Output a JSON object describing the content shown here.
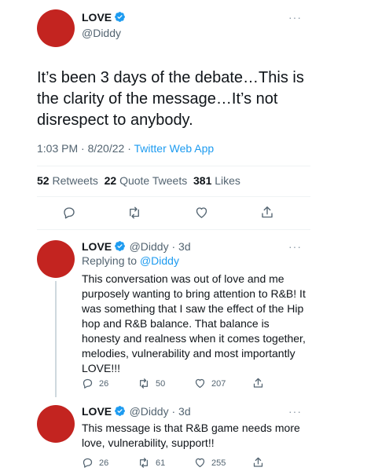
{
  "main_tweet": {
    "author_name": "LOVE",
    "author_handle": "@Diddy",
    "more": "···",
    "text": "It’s been 3 days of the debate…This is the clarity of the message…It’s not disrespect to anybody.",
    "time": "1:03 PM",
    "date": "8/20/22",
    "source": "Twitter Web App",
    "retweets_count": "52",
    "retweets_label": "Retweets",
    "quotes_count": "22",
    "quotes_label": "Quote Tweets",
    "likes_count": "381",
    "likes_label": "Likes",
    "icons": [
      "reply-icon",
      "retweet-icon",
      "like-icon",
      "share-icon"
    ]
  },
  "replies": [
    {
      "author_name": "LOVE",
      "author_handle": "@Diddy",
      "age": "3d",
      "more": "···",
      "replying_prefix": "Replying to",
      "replying_handle": "@Diddy",
      "text": "This conversation was out of love and me purposely wanting to bring attention to R&B! It was something that I saw the effect of the Hip hop and R&B balance. That balance is honesty and realness when it comes together, melodies, vulnerability and most importantly LOVE!!!",
      "replies_count": "26",
      "retweets_count": "50",
      "likes_count": "207"
    },
    {
      "author_name": "LOVE",
      "author_handle": "@Diddy",
      "age": "3d",
      "more": "···",
      "text": "This message is that R&B game needs more love, vulnerability, support!!",
      "replies_count": "26",
      "retweets_count": "61",
      "likes_count": "255"
    }
  ],
  "colors": {
    "avatar": "#c32420",
    "verified": "#1d9bf0",
    "link": "#1d9bf0",
    "muted": "#536471"
  }
}
